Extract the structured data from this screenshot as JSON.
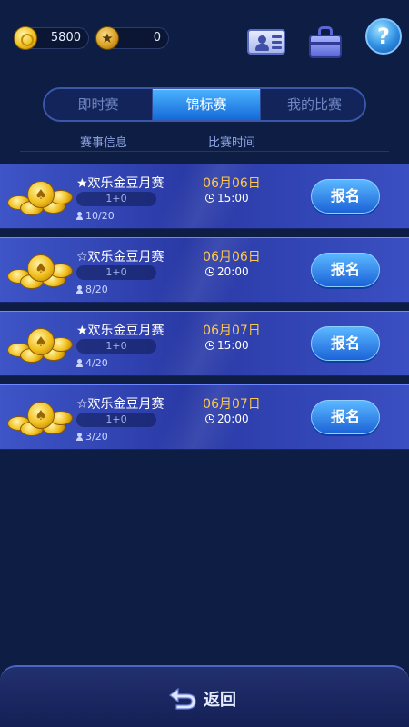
{
  "wallet": {
    "coins": "5800",
    "stars": "0"
  },
  "tabs": [
    {
      "label": "即时赛",
      "active": false
    },
    {
      "label": "锦标赛",
      "active": true
    },
    {
      "label": "我的比赛",
      "active": false
    }
  ],
  "columns": {
    "info": "赛事信息",
    "time": "比赛时间"
  },
  "matches": [
    {
      "name": "★欢乐金豆月赛",
      "sub": "1+0",
      "players": "10/20",
      "date": "06月06日",
      "time": "15:00",
      "button": "报名"
    },
    {
      "name": "☆欢乐金豆月赛",
      "sub": "1+0",
      "players": "8/20",
      "date": "06月06日",
      "time": "20:00",
      "button": "报名"
    },
    {
      "name": "★欢乐金豆月赛",
      "sub": "1+0",
      "players": "4/20",
      "date": "06月07日",
      "time": "15:00",
      "button": "报名"
    },
    {
      "name": "☆欢乐金豆月赛",
      "sub": "1+0",
      "players": "3/20",
      "date": "06月07日",
      "time": "20:00",
      "button": "报名"
    }
  ],
  "footer": {
    "back_label": "返回"
  },
  "colors": {
    "background": "#0e1d44",
    "accent": "#1c63d8",
    "date": "#ffc848"
  },
  "icons": [
    "coin-icon",
    "star-coin-icon",
    "id-card-icon",
    "bag-icon",
    "help-icon",
    "user-icon",
    "clock-icon",
    "back-arrow-icon"
  ]
}
